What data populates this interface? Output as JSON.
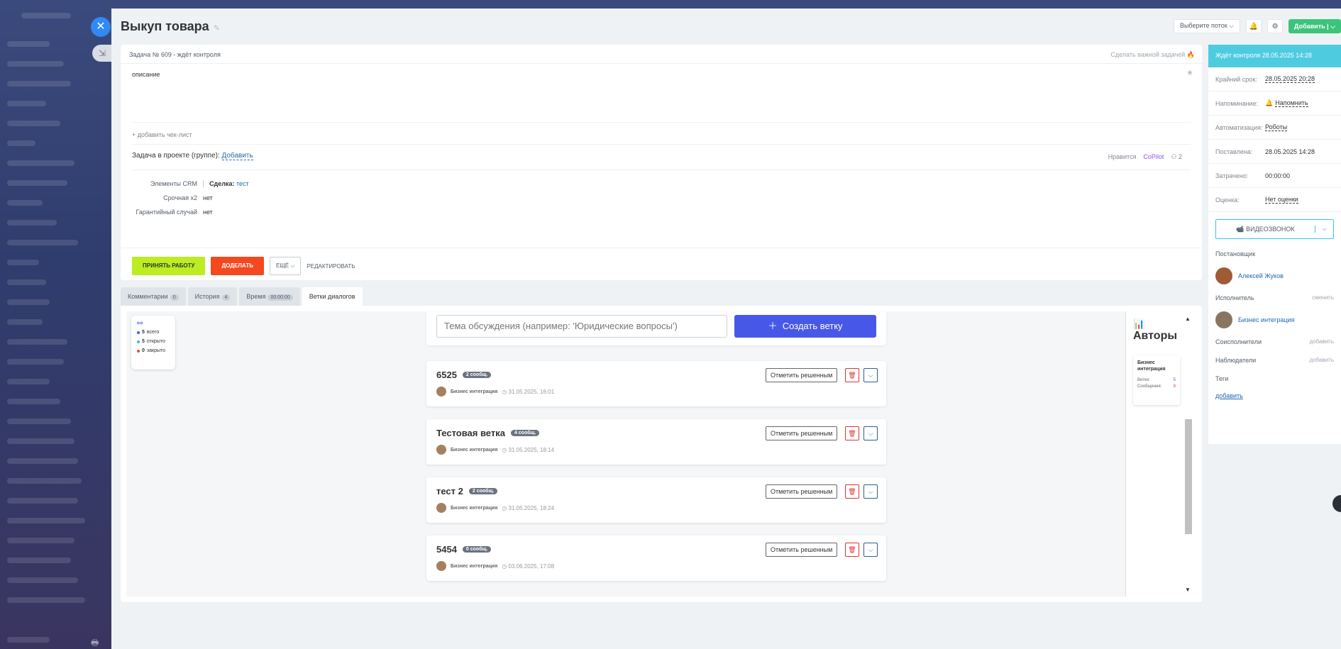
{
  "page": {
    "title": "Выкуп товара",
    "flow_select": "Выберите поток",
    "add_button": "Добавить"
  },
  "task": {
    "header": "Задача № 609 - ждёт контроля",
    "make_important": "Сделать важной задачей",
    "description": "описание",
    "add_checklist": "+ добавить чек-лист",
    "project_label": "Задача в проекте (группе):",
    "project_link": "Добавить",
    "like": "Нравится",
    "copilot": "CoPilot",
    "copilot_count": "2",
    "crm": [
      {
        "label": "Элементы CRM",
        "key": "Сделка:",
        "value": "тест"
      },
      {
        "label": "Срочная x2",
        "key": "",
        "value": "нет"
      },
      {
        "label": "Гарантийный случай",
        "key": "",
        "value": "нет"
      }
    ],
    "actions": {
      "accept": "ПРИНЯТЬ РАБОТУ",
      "redo": "ДОДЕЛАТЬ",
      "more": "ЕЩЁ",
      "edit": "РЕДАКТИРОВАТЬ"
    }
  },
  "tabs": [
    {
      "label": "Комментарии",
      "count": "0"
    },
    {
      "label": "История",
      "count": "4"
    },
    {
      "label": "Время",
      "count": "00:00:00"
    },
    {
      "label": "Ветки диалогов",
      "count": ""
    }
  ],
  "dialog": {
    "stats": {
      "total_count": "5",
      "total_label": "всего",
      "open_count": "5",
      "open_label": "открыто",
      "closed_count": "0",
      "closed_label": "закрыто"
    },
    "topic_placeholder": "Тема обсуждения (например: 'Юридические вопросы')",
    "create_button": "Создать ветку",
    "resolve_label": "Отметить решенным",
    "branches": [
      {
        "title": "6525",
        "badge": "2 сообщ.",
        "author": "Бизнес интеграция",
        "date": "31.05.2025, 16:01"
      },
      {
        "title": "Тестовая ветка",
        "badge": "4 сообщ.",
        "author": "Бизнес интеграция",
        "date": "31.05.2025, 18:14"
      },
      {
        "title": "тест 2",
        "badge": "2 сообщ.",
        "author": "Бизнес интеграция",
        "date": "31.05.2025, 18:24"
      },
      {
        "title": "5454",
        "badge": "0 сообщ.",
        "author": "Бизнес интеграция",
        "date": "03.06.2025, 17:08"
      }
    ],
    "authors": {
      "title": "Авторы",
      "card_name": "Бизнес интеграция",
      "branches_label": "Ветки:",
      "branches_value": "5",
      "messages_label": "Сообщения:",
      "messages_value": "8"
    }
  },
  "sidebar": {
    "status": "Ждёт контроля 28.05.2025 14:28",
    "rows": [
      {
        "label": "Крайний срок:",
        "value": "28.05.2025 20:28"
      },
      {
        "label": "Напоминание:",
        "value": "Напомнить"
      },
      {
        "label": "Автоматизация:",
        "value": "Роботы"
      },
      {
        "label": "Поставлена:",
        "value": "28.05.2025 14:28"
      },
      {
        "label": "Затрачено:",
        "value": "00:00:00"
      },
      {
        "label": "Оценка:",
        "value": "Нет оценки"
      }
    ],
    "video_call": "ВИДЕОЗВОНОК",
    "creator_label": "Постановщик",
    "creator": "Алексей Жуков",
    "assignee_label": "Исполнитель",
    "assignee_action": "сменить",
    "assignee": "Бизнес интеграция",
    "coexec_label": "Соисполнители",
    "coexec_action": "добавить",
    "observers_label": "Наблюдатели",
    "observers_action": "добавить",
    "tags_label": "Теги",
    "tags_add": "добавить"
  }
}
